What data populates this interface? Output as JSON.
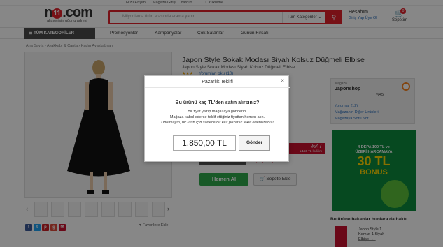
{
  "topbar": {
    "items": [
      "Hızlı Erişim",
      "Mağaza Girişi",
      "Yardım",
      "TL Yükleme"
    ]
  },
  "header": {
    "logo_text": "n11.com",
    "tagline": "alışverişin uğurlu adresi",
    "search_placeholder": "Milyonlarca ürün arasında arama yapın.",
    "search_category": "Tüm Kategoriler",
    "account_title": "Hesabım",
    "account_links": "Giriş Yap  Üye Ol",
    "cart_label": "Sepetim",
    "cart_count": "0"
  },
  "nav": {
    "categories_label": "TÜM KATEGORİLER",
    "items": [
      "Promosyonlar",
      "Kampanyalar",
      "Çok Satanlar",
      "Günün Fırsatı"
    ]
  },
  "breadcrumb": "Ana Sayfa  ›  Ayakkabı & Çanta  ›  Kadın Ayakkabıları",
  "product": {
    "title": "Japon Style Sokak Modası Siyah Kolsuz Düğmeli Elbise",
    "subtitle": "Japon Style Sokak Modası Siyah Kolsuz Düğmeli Elbise",
    "stars": "★★★",
    "reviews": "Yorumları oku (10)",
    "discount_pct": "%47",
    "discount_amount": "1.150 TL İndirim",
    "teklif_button": "Pazarlık Teklif Et",
    "kampanya_text": "Kampanyalı sepetine ekle",
    "buy_button": "Hemen Al",
    "cart_button": "Sepete Ekle",
    "favorites": "Favorilere Ekle"
  },
  "store": {
    "label": "Mağaza",
    "name": "Japonshop",
    "score": "%45",
    "links": [
      "Yorumlar (12)",
      "Mağazanın Diğer Ürünleri",
      "Mağazaya Soru Sor"
    ]
  },
  "ad": {
    "line1": "4 DEPA 100 TL ve",
    "line2": "ÜZERİ HARCAMAYA",
    "big": "30 TL",
    "bonus": "BONUS"
  },
  "also_bought": {
    "heading": "Bu ürüne bakanlar bunlara da baktı",
    "item_title": "Japon Style 1 Kırmızı 1 Siyah Elbise",
    "old_price": "135,50 TL",
    "new_price": "..."
  },
  "modal": {
    "title": "Pazarlık Teklifi",
    "question": "Bu ürünü kaç TL'den satın alırsınız?",
    "line1": "Bir fiyat yazıp mağazaya gönderin.",
    "line2": "Mağaza kabul ederse teklif ettiğiniz fiyattan hemen alın.",
    "line3": "Unutmayın, bir ürün için sadece bir kez pazarlık teklif edebilirsiniz!",
    "price_value": "1.850,00 TL",
    "send_button": "Gönder",
    "close": "×"
  },
  "colors": {
    "brand_red": "#e0202b",
    "buy_green": "#2fa84a"
  }
}
